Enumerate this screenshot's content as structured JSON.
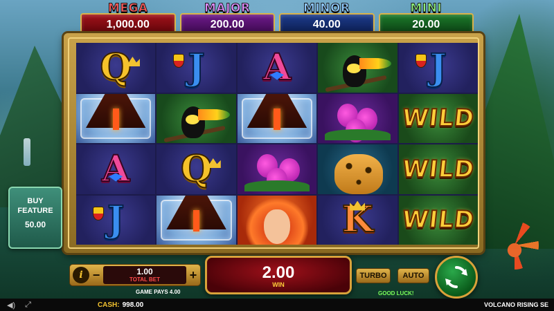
{
  "jackpots": [
    {
      "title": "MEGA",
      "value": "1,000.00"
    },
    {
      "title": "MAJOR",
      "value": "200.00"
    },
    {
      "title": "MINOR",
      "value": "40.00"
    },
    {
      "title": "MINI",
      "value": "20.00"
    }
  ],
  "reels": {
    "letters": {
      "q": "Q",
      "j": "J",
      "a": "A",
      "k": "K"
    },
    "wild": "WILD"
  },
  "buy_feature": {
    "label": "BUY FEATURE",
    "price": "50.00"
  },
  "controls": {
    "info": "i",
    "minus": "−",
    "plus": "+",
    "total_bet_value": "1.00",
    "total_bet_label": "TOTAL BET",
    "win_value": "2.00",
    "win_label": "WIN",
    "turbo": "TURBO",
    "auto": "AUTO",
    "game_pays": "GAME PAYS 4.00",
    "good_luck": "GOOD LUCK!"
  },
  "status_bar": {
    "cash_label": "CASH:",
    "cash_value": "998.00",
    "game_name": "VOLCANO RISING SE"
  },
  "icons": [
    "speaker-icon",
    "fullscreen-icon",
    "spin-arrows-icon",
    "crown-icon",
    "shield-icon"
  ],
  "colors": {
    "mega": "#a1121a",
    "major": "#6e1a8a",
    "minor": "#1d3c8c",
    "mini": "#1c7a2a",
    "gold": "#d9a23a",
    "spin": "#2aa84a"
  }
}
